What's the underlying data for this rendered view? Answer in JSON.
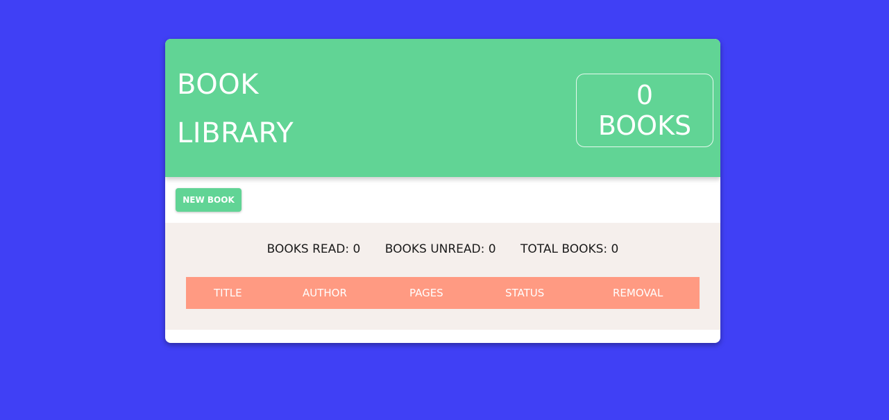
{
  "header": {
    "title_line1": "BOOK",
    "title_line2": "LIBRARY",
    "count_value": "0",
    "count_unit": "BOOKS"
  },
  "toolbar": {
    "new_book_label": "NEW BOOK"
  },
  "stats": {
    "read": "BOOKS READ: 0",
    "unread": "BOOKS UNREAD: 0",
    "total": "TOTAL BOOKS: 0"
  },
  "table": {
    "columns": [
      "TITLE",
      "AUTHOR",
      "PAGES",
      "STATUS",
      "REMOVAL"
    ]
  },
  "colors": {
    "background": "#4040f5",
    "header": "#61d495",
    "table_header": "#ff9a82",
    "stats_background": "#f5efec"
  }
}
